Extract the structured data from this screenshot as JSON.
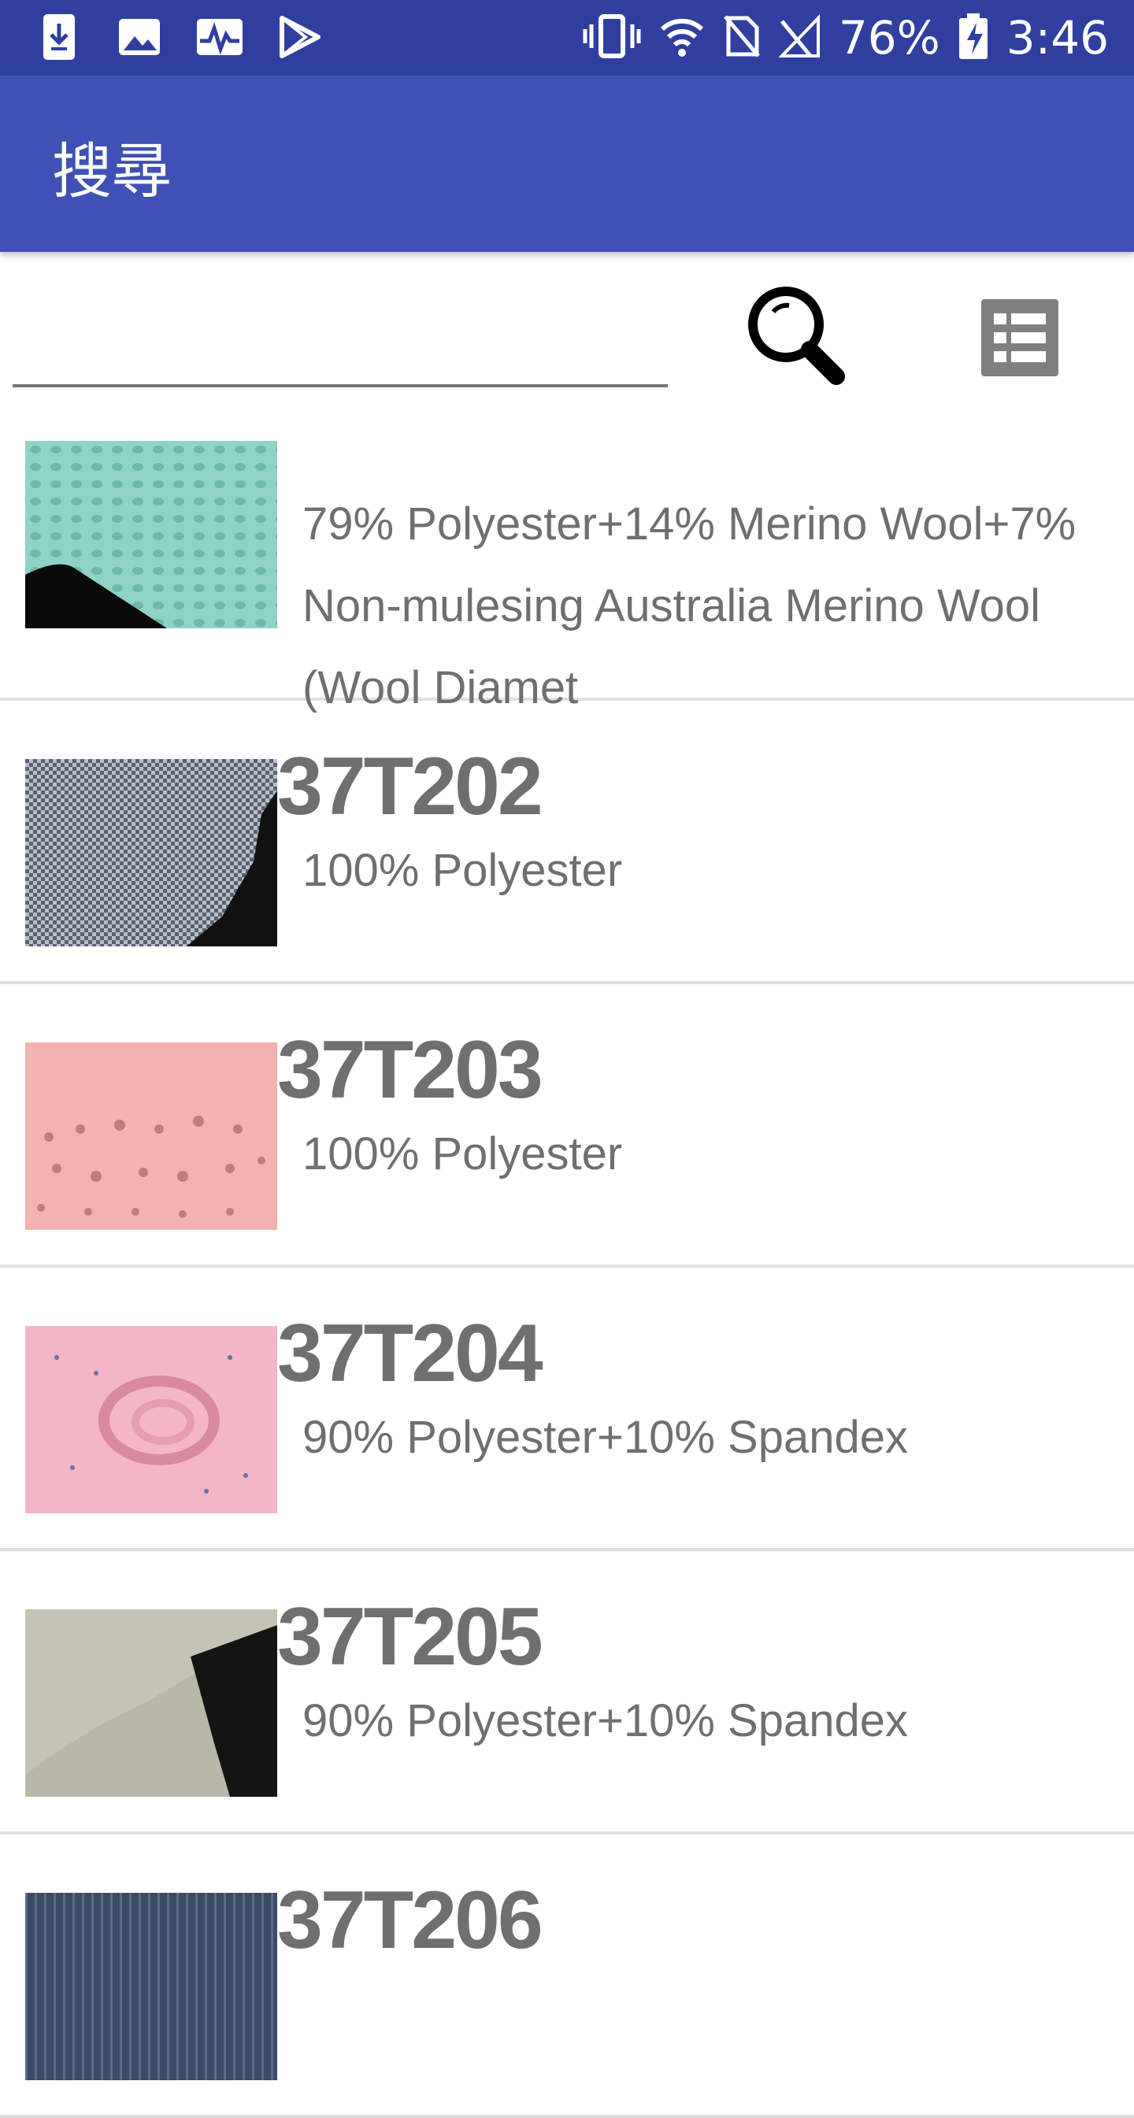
{
  "status_bar": {
    "battery": "76%",
    "time": "3:46",
    "left_icons": [
      "download-icon",
      "image-icon",
      "activity-icon",
      "play-store-icon"
    ],
    "right_icons": [
      "vibrate-icon",
      "wifi-icon",
      "no-sim-icon",
      "signal-icon",
      "battery-charging-icon"
    ]
  },
  "app_bar": {
    "title": "搜尋"
  },
  "search": {
    "value": "",
    "placeholder": "",
    "search_icon": "search-icon",
    "list_icon": "list-view-icon"
  },
  "products": [
    {
      "code": "",
      "description": "79% Polyester+14% Merino Wool+7% Non-mulesing Australia Merino Wool (Wool Diamet",
      "thumb_color": "#8fd3c6"
    },
    {
      "code": "37T202",
      "description": "100% Polyester",
      "thumb_color": "#9aa2ad"
    },
    {
      "code": "37T203",
      "description": "100% Polyester",
      "thumb_color": "#f2b2b0"
    },
    {
      "code": "37T204",
      "description": "90% Polyester+10% Spandex",
      "thumb_color": "#f3b6c7"
    },
    {
      "code": "37T205",
      "description": "90% Polyester+10% Spandex",
      "thumb_color": "#b8b8a8"
    },
    {
      "code": "37T206",
      "description": "",
      "thumb_color": "#3c4a66"
    }
  ],
  "colors": {
    "status_bar": "#303f9f",
    "app_bar": "#3f51b5",
    "text_gray": "#6f6f6f",
    "divider": "#e0e0e0"
  }
}
